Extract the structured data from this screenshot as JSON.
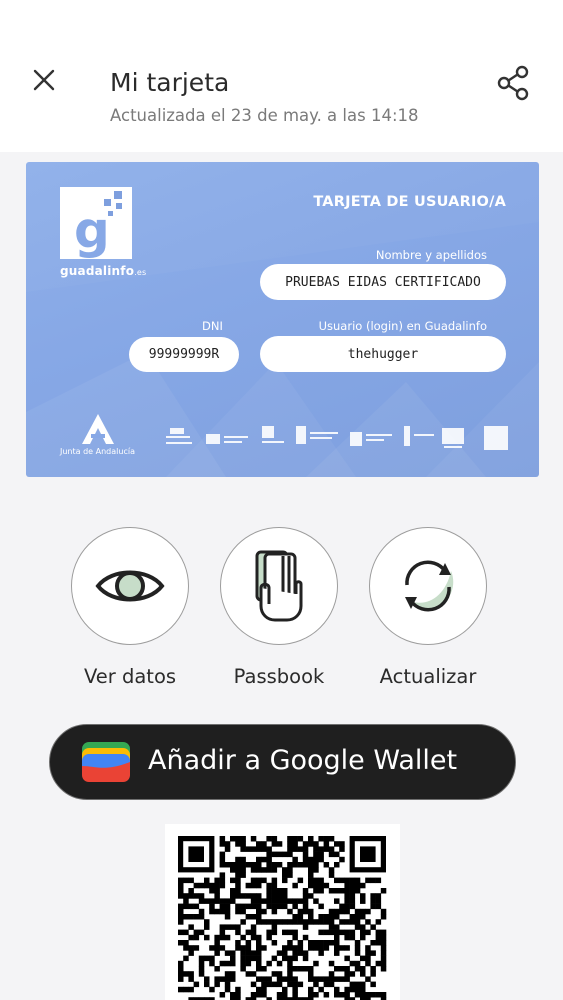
{
  "header": {
    "title": "Mi tarjeta",
    "subtitle": "Actualizada el 23 de may. a las 14:18",
    "close_icon": "close-icon",
    "share_icon": "share-icon"
  },
  "card": {
    "heading": "TARJETA DE USUARIO/A",
    "logo_text": "guadalinfo",
    "logo_suffix": ".es",
    "name_label": "Nombre y apellidos",
    "name_value": "PRUEBAS EIDAS CERTIFICADO",
    "dni_label": "DNI",
    "dni_value": "99999999R",
    "user_label": "Usuario (login) en Guadalinfo",
    "user_value": "thehugger",
    "junta_text": "Junta de Andalucía",
    "colors": {
      "card_blue": "#87a8e6",
      "text_white": "#ffffff"
    }
  },
  "actions": [
    {
      "label": "Ver datos",
      "icon": "eye-icon"
    },
    {
      "label": "Passbook",
      "icon": "cards-hand-icon"
    },
    {
      "label": "Actualizar",
      "icon": "refresh-icon"
    }
  ],
  "wallet": {
    "label": "Añadir a Google Wallet",
    "icon": "google-wallet-icon",
    "colors": {
      "background": "#1f1f1f",
      "text": "#ffffff"
    }
  },
  "qr": {
    "icon": "qr-code-icon"
  }
}
